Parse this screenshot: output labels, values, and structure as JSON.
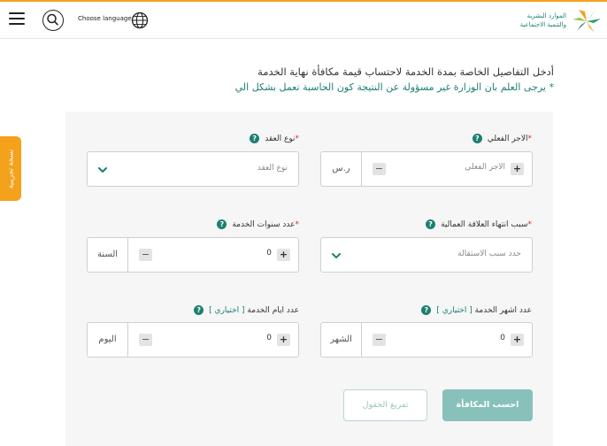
{
  "header": {
    "choose_language": "Choose language",
    "logo_line1": "الموارد البشرية",
    "logo_line2": "والتنمية الاجتماعية"
  },
  "side_tab": {
    "label": "نسخة تجريبية"
  },
  "intro": {
    "title": "أدخل التفاصيل الخاصة بمدة الخدمة لاحتساب قيمة مكافأة نهاية الخدمة",
    "note": "* يرجى العلم بان الوزارة غير مسؤولة عن النتيجة كون الحاسبة تعمل بشكل الي"
  },
  "fields": {
    "salary": {
      "label": "الاجر الفعلي",
      "required": "*",
      "placeholder": "الاجر الفعلي",
      "unit": "ر.س",
      "plus": "+",
      "minus": "−"
    },
    "contract_type": {
      "label": "نوع العقد",
      "required": "*",
      "placeholder": "نوع العقد"
    },
    "termination_reason": {
      "label": "سبب انتهاء العلاقة العمالية",
      "required": "*",
      "placeholder": "حدد سبب الاستقالة"
    },
    "service_years": {
      "label": "عدد سنوات الخدمة",
      "required": "*",
      "value": "0",
      "unit": "السنة",
      "plus": "+",
      "minus": "−"
    },
    "service_months": {
      "label": "عدد اشهر الخدمة",
      "optional": "[ اختياري ]",
      "value": "0",
      "unit": "الشهر",
      "plus": "+",
      "minus": "−"
    },
    "service_days": {
      "label": "عدد ايام الخدمة",
      "optional": "[ اختياري ]",
      "value": "0",
      "unit": "اليوم",
      "plus": "+",
      "minus": "−"
    }
  },
  "help_glyph": "?",
  "buttons": {
    "calculate": "احسب المكافأة",
    "clear": "تفريغ الحقول"
  },
  "colors": {
    "accent": "#1c7f72",
    "orange": "#f4a11c",
    "button_disabled": "#88c1b9"
  }
}
